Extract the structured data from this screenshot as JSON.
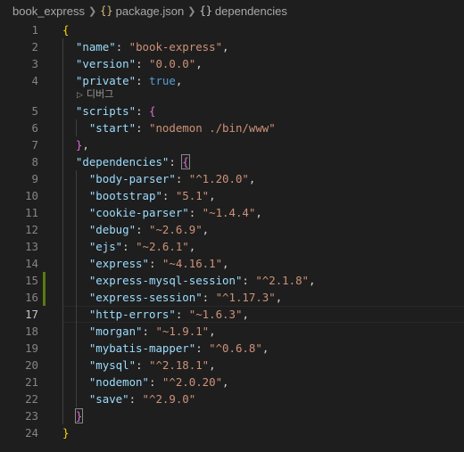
{
  "breadcrumb": {
    "folder": "book_express",
    "file": "package.json",
    "symbol": "dependencies",
    "file_icon": "json-braces-icon",
    "symbol_icon": "object-braces-icon"
  },
  "codelens": {
    "label": "디버그",
    "icon": "play-icon"
  },
  "colors": {
    "background": "#1e1e1e",
    "key": "#9cdcfe",
    "string": "#ce9178",
    "keyword": "#569cd6",
    "bracket_level1": "#ffd700",
    "bracket_level2": "#da70d6",
    "bracket_level3": "#179fff",
    "git_modified": "#587c0c"
  },
  "editor": {
    "active_line": 17,
    "modified_lines": [
      15,
      16
    ],
    "lines": [
      {
        "num": "1",
        "tokens": [
          {
            "t": "b1",
            "v": "{"
          }
        ]
      },
      {
        "num": "2",
        "tokens": [
          {
            "t": "p",
            "v": "  "
          },
          {
            "t": "k",
            "v": "\"name\""
          },
          {
            "t": "p",
            "v": ": "
          },
          {
            "t": "s",
            "v": "\"book-express\""
          },
          {
            "t": "p",
            "v": ","
          }
        ]
      },
      {
        "num": "3",
        "tokens": [
          {
            "t": "p",
            "v": "  "
          },
          {
            "t": "k",
            "v": "\"version\""
          },
          {
            "t": "p",
            "v": ": "
          },
          {
            "t": "s",
            "v": "\"0.0.0\""
          },
          {
            "t": "p",
            "v": ","
          }
        ]
      },
      {
        "num": "4",
        "tokens": [
          {
            "t": "p",
            "v": "  "
          },
          {
            "t": "k",
            "v": "\"private\""
          },
          {
            "t": "p",
            "v": ": "
          },
          {
            "t": "kw",
            "v": "true"
          },
          {
            "t": "p",
            "v": ","
          }
        ]
      },
      {
        "num": "5",
        "tokens": [
          {
            "t": "p",
            "v": "  "
          },
          {
            "t": "k",
            "v": "\"scripts\""
          },
          {
            "t": "p",
            "v": ": "
          },
          {
            "t": "b2",
            "v": "{"
          }
        ]
      },
      {
        "num": "6",
        "tokens": [
          {
            "t": "p",
            "v": "    "
          },
          {
            "t": "k",
            "v": "\"start\""
          },
          {
            "t": "p",
            "v": ": "
          },
          {
            "t": "s",
            "v": "\"nodemon ./bin/www\""
          }
        ]
      },
      {
        "num": "7",
        "tokens": [
          {
            "t": "p",
            "v": "  "
          },
          {
            "t": "b2",
            "v": "}"
          },
          {
            "t": "p",
            "v": ","
          }
        ]
      },
      {
        "num": "8",
        "tokens": [
          {
            "t": "p",
            "v": "  "
          },
          {
            "t": "k",
            "v": "\"dependencies\""
          },
          {
            "t": "p",
            "v": ": "
          },
          {
            "t": "b2m",
            "v": "{"
          }
        ]
      },
      {
        "num": "9",
        "tokens": [
          {
            "t": "p",
            "v": "    "
          },
          {
            "t": "k",
            "v": "\"body-parser\""
          },
          {
            "t": "p",
            "v": ": "
          },
          {
            "t": "s",
            "v": "\"^1.20.0\""
          },
          {
            "t": "p",
            "v": ","
          }
        ]
      },
      {
        "num": "10",
        "tokens": [
          {
            "t": "p",
            "v": "    "
          },
          {
            "t": "k",
            "v": "\"bootstrap\""
          },
          {
            "t": "p",
            "v": ": "
          },
          {
            "t": "s",
            "v": "\"5.1\""
          },
          {
            "t": "p",
            "v": ","
          }
        ]
      },
      {
        "num": "11",
        "tokens": [
          {
            "t": "p",
            "v": "    "
          },
          {
            "t": "k",
            "v": "\"cookie-parser\""
          },
          {
            "t": "p",
            "v": ": "
          },
          {
            "t": "s",
            "v": "\"~1.4.4\""
          },
          {
            "t": "p",
            "v": ","
          }
        ]
      },
      {
        "num": "12",
        "tokens": [
          {
            "t": "p",
            "v": "    "
          },
          {
            "t": "k",
            "v": "\"debug\""
          },
          {
            "t": "p",
            "v": ": "
          },
          {
            "t": "s",
            "v": "\"~2.6.9\""
          },
          {
            "t": "p",
            "v": ","
          }
        ]
      },
      {
        "num": "13",
        "tokens": [
          {
            "t": "p",
            "v": "    "
          },
          {
            "t": "k",
            "v": "\"ejs\""
          },
          {
            "t": "p",
            "v": ": "
          },
          {
            "t": "s",
            "v": "\"~2.6.1\""
          },
          {
            "t": "p",
            "v": ","
          }
        ]
      },
      {
        "num": "14",
        "tokens": [
          {
            "t": "p",
            "v": "    "
          },
          {
            "t": "k",
            "v": "\"express\""
          },
          {
            "t": "p",
            "v": ": "
          },
          {
            "t": "s",
            "v": "\"~4.16.1\""
          },
          {
            "t": "p",
            "v": ","
          }
        ]
      },
      {
        "num": "15",
        "tokens": [
          {
            "t": "p",
            "v": "    "
          },
          {
            "t": "k",
            "v": "\"express-mysql-session\""
          },
          {
            "t": "p",
            "v": ": "
          },
          {
            "t": "s",
            "v": "\"^2.1.8\""
          },
          {
            "t": "p",
            "v": ","
          }
        ]
      },
      {
        "num": "16",
        "tokens": [
          {
            "t": "p",
            "v": "    "
          },
          {
            "t": "k",
            "v": "\"express-session\""
          },
          {
            "t": "p",
            "v": ": "
          },
          {
            "t": "s",
            "v": "\"^1.17.3\""
          },
          {
            "t": "p",
            "v": ","
          }
        ]
      },
      {
        "num": "17",
        "tokens": [
          {
            "t": "p",
            "v": "    "
          },
          {
            "t": "k",
            "v": "\"http-errors\""
          },
          {
            "t": "p",
            "v": ": "
          },
          {
            "t": "s",
            "v": "\"~1.6.3\""
          },
          {
            "t": "p",
            "v": ","
          }
        ]
      },
      {
        "num": "18",
        "tokens": [
          {
            "t": "p",
            "v": "    "
          },
          {
            "t": "k",
            "v": "\"morgan\""
          },
          {
            "t": "p",
            "v": ": "
          },
          {
            "t": "s",
            "v": "\"~1.9.1\""
          },
          {
            "t": "p",
            "v": ","
          }
        ]
      },
      {
        "num": "19",
        "tokens": [
          {
            "t": "p",
            "v": "    "
          },
          {
            "t": "k",
            "v": "\"mybatis-mapper\""
          },
          {
            "t": "p",
            "v": ": "
          },
          {
            "t": "s",
            "v": "\"^0.6.8\""
          },
          {
            "t": "p",
            "v": ","
          }
        ]
      },
      {
        "num": "20",
        "tokens": [
          {
            "t": "p",
            "v": "    "
          },
          {
            "t": "k",
            "v": "\"mysql\""
          },
          {
            "t": "p",
            "v": ": "
          },
          {
            "t": "s",
            "v": "\"^2.18.1\""
          },
          {
            "t": "p",
            "v": ","
          }
        ]
      },
      {
        "num": "21",
        "tokens": [
          {
            "t": "p",
            "v": "    "
          },
          {
            "t": "k",
            "v": "\"nodemon\""
          },
          {
            "t": "p",
            "v": ": "
          },
          {
            "t": "s",
            "v": "\"^2.0.20\""
          },
          {
            "t": "p",
            "v": ","
          }
        ]
      },
      {
        "num": "22",
        "tokens": [
          {
            "t": "p",
            "v": "    "
          },
          {
            "t": "k",
            "v": "\"save\""
          },
          {
            "t": "p",
            "v": ": "
          },
          {
            "t": "s",
            "v": "\"^2.9.0\""
          }
        ]
      },
      {
        "num": "23",
        "tokens": [
          {
            "t": "p",
            "v": "  "
          },
          {
            "t": "b2m",
            "v": "}"
          }
        ]
      },
      {
        "num": "24",
        "tokens": [
          {
            "t": "b1",
            "v": "}"
          }
        ]
      }
    ]
  }
}
